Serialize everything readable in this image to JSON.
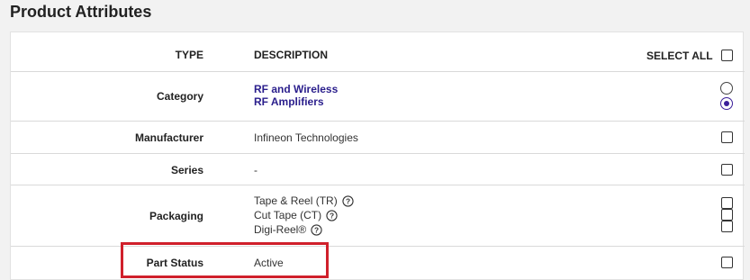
{
  "section": {
    "title": "Product Attributes"
  },
  "table": {
    "headers": {
      "type": "TYPE",
      "description": "DESCRIPTION",
      "select_all": "SELECT ALL"
    },
    "rows": [
      {
        "type": "Category",
        "values": [
          "RF and Wireless",
          "RF Amplifiers"
        ],
        "control": "radio",
        "selected_index": 1
      },
      {
        "type": "Manufacturer",
        "values": [
          "Infineon Technologies"
        ],
        "control": "checkbox",
        "checked": false
      },
      {
        "type": "Series",
        "values": [
          "-"
        ],
        "control": "checkbox",
        "checked": false
      },
      {
        "type": "Packaging",
        "values": [
          "Tape & Reel (TR)",
          "Cut Tape (CT)",
          "Digi-Reel®"
        ],
        "control": "checkbox-each",
        "checked": false
      },
      {
        "type": "Part Status",
        "values": [
          "Active"
        ],
        "control": "checkbox",
        "checked": false
      }
    ]
  },
  "highlight": {
    "color": "#d0202b"
  },
  "icons": {
    "help": "question-circle-icon"
  },
  "colors": {
    "link": "#2a1e8c",
    "radio_selected": "#3b1f9a"
  }
}
